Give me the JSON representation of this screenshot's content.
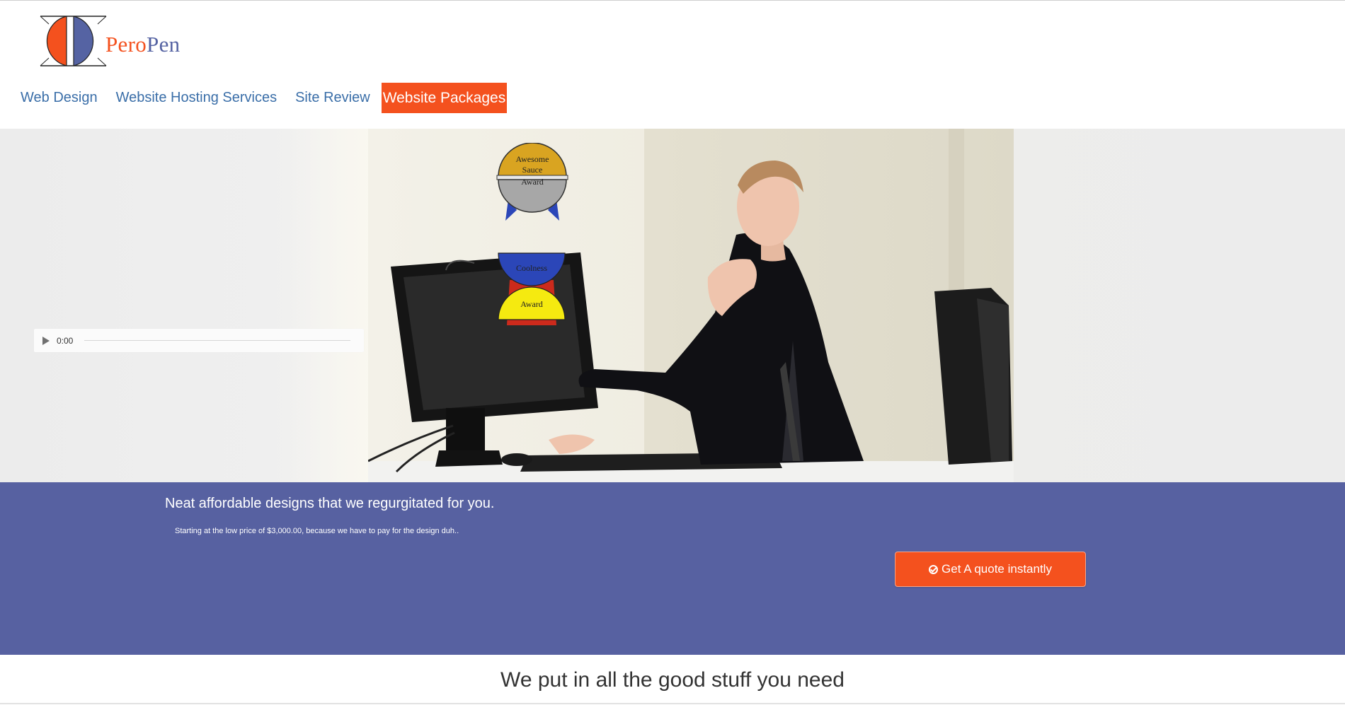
{
  "logo": {
    "brand_part1": "Pero",
    "brand_part2": "Pen",
    "colors": {
      "orange": "#f4511e",
      "blue": "#5563a3"
    }
  },
  "nav": {
    "items": [
      {
        "label": "Web Design",
        "active": false
      },
      {
        "label": "Website Hosting Services",
        "active": false
      },
      {
        "label": "Site Review",
        "active": false
      },
      {
        "label": "Website Packages",
        "active": true
      }
    ]
  },
  "audio": {
    "time": "0:00",
    "play_icon": "play-icon"
  },
  "badges": {
    "awesome": {
      "line1": "Awesome",
      "line2": "Sauce",
      "line3": "Award"
    },
    "coolness": {
      "top": "Coolness",
      "bottom": "Award"
    }
  },
  "promo": {
    "headline": "Neat affordable designs that we regurgitated for you.",
    "subtext": "Starting at the low price of $3,000.00, because we have to pay for the design duh..",
    "cta_label": "Get A quote instantly",
    "cta_icon": "check-circle-icon",
    "band_color": "#5761a1",
    "cta_color": "#f4511e"
  },
  "section": {
    "title": "We put in all the good stuff you need"
  }
}
